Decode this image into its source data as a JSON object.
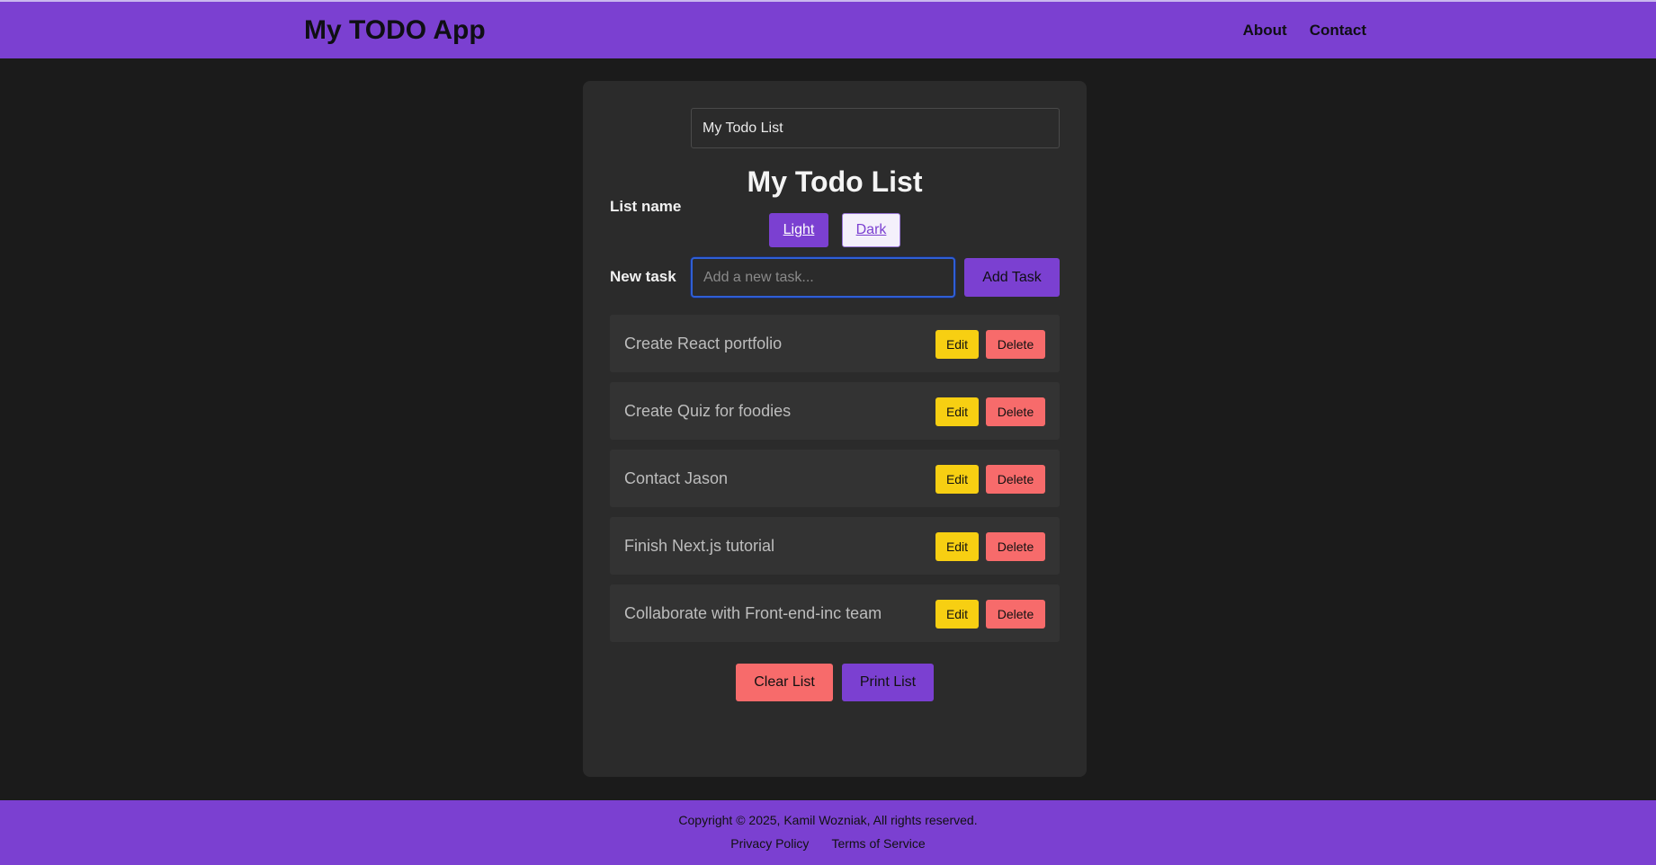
{
  "header": {
    "title": "My TODO App",
    "nav": [
      "About",
      "Contact"
    ]
  },
  "form": {
    "list_name_label": "List name",
    "list_name_value": "My Todo List",
    "new_task_label": "New task",
    "new_task_placeholder": "Add a new task...",
    "new_task_value": "",
    "add_button": "Add Task"
  },
  "list": {
    "heading": "My Todo List",
    "theme_light": "Light",
    "theme_dark": "Dark",
    "tasks": [
      {
        "text": "Create React portfolio"
      },
      {
        "text": "Create Quiz for foodies"
      },
      {
        "text": "Contact Jason"
      },
      {
        "text": "Finish Next.js tutorial"
      },
      {
        "text": "Collaborate with Front-end-inc team"
      }
    ],
    "edit_label": "Edit",
    "delete_label": "Delete",
    "clear_button": "Clear List",
    "print_button": "Print List"
  },
  "footer": {
    "copyright": "Copyright © 2025, Kamil Wozniak, All rights reserved.",
    "links": [
      "Privacy Policy",
      "Terms of Service"
    ]
  },
  "colors": {
    "accent": "#7b40d1",
    "background": "#1b1b1b",
    "card": "#2b2b2b",
    "edit": "#f7cf12",
    "delete": "#f76b6b"
  }
}
